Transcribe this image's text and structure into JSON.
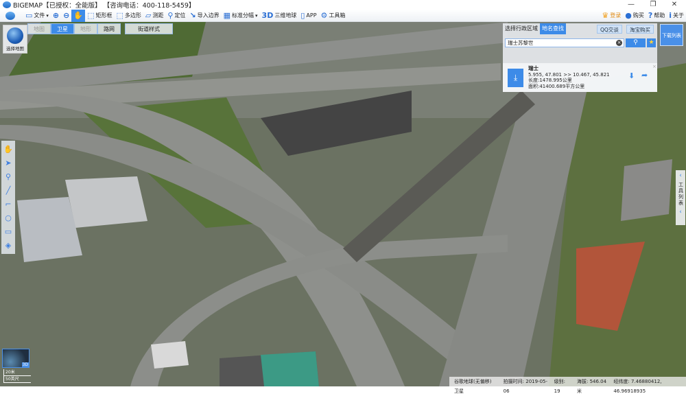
{
  "window": {
    "title": "BIGEMAP【已授权：全能版】 【咨询电话：400-118-5459】",
    "minimize": "—",
    "restore": "❐",
    "close": "✕"
  },
  "toolbar": {
    "items": [
      {
        "label": "文件",
        "icon": "folder-icon",
        "glyph": "▭",
        "dropdown": true
      },
      {
        "label": "",
        "icon": "zoom-in-icon",
        "glyph": "⊕"
      },
      {
        "label": "",
        "icon": "zoom-out-icon",
        "glyph": "⊖"
      },
      {
        "label": "",
        "icon": "hand-pan-icon",
        "glyph": "✋",
        "active": true
      },
      {
        "label": "矩形框",
        "icon": "rectangle-select-icon",
        "glyph": "⬚"
      },
      {
        "label": "多边形",
        "icon": "polygon-select-icon",
        "glyph": "⬚"
      },
      {
        "label": "测距",
        "icon": "ruler-icon",
        "glyph": "▱"
      },
      {
        "label": "定位",
        "icon": "location-pin-icon",
        "glyph": "⚲"
      },
      {
        "label": "导入边界",
        "icon": "import-boundary-icon",
        "glyph": "↘"
      },
      {
        "label": "标准分幅",
        "icon": "grid-icon",
        "glyph": "▦",
        "dropdown": true
      },
      {
        "label": "三维地球",
        "icon": "3d-icon",
        "glyph": "3D"
      },
      {
        "label": "APP",
        "icon": "phone-app-icon",
        "glyph": "▯"
      },
      {
        "label": "工具箱",
        "icon": "gear-icon",
        "glyph": "⚙"
      }
    ],
    "right": [
      {
        "label": "登录",
        "icon": "login-badge-icon",
        "glyph": "♛"
      },
      {
        "label": "购买",
        "icon": "buy-icon",
        "glyph": "●"
      },
      {
        "label": "帮助",
        "icon": "help-icon",
        "glyph": "?"
      },
      {
        "label": "关于",
        "icon": "about-icon",
        "glyph": "i"
      }
    ]
  },
  "map_types": {
    "items": [
      "地图",
      "卫星",
      "地形",
      "路网"
    ],
    "active": "卫星",
    "street_style": "街道样式"
  },
  "globe": {
    "label": "选择地图"
  },
  "left_tools": [
    "hand-icon",
    "arrow-icon",
    "marker-icon",
    "line-icon",
    "polyline-icon",
    "circle-icon",
    "rectangle-icon",
    "eraser-icon"
  ],
  "search_panel": {
    "tab_region": "选择行政区域",
    "tab_search": "地名查找",
    "qq": "QQ交谈",
    "taobao": "淘宝购买",
    "query": "瑞士苏黎世",
    "clear": "×",
    "search_glyph": "⚲",
    "star_glyph": "★"
  },
  "result": {
    "name": "瑞士",
    "coords": "5.955, 47.801 >> 10.467, 45.821",
    "length": "长度:1478.995公里",
    "area": "面积:41400.689平方公里",
    "close": "×"
  },
  "download_list": "下载列表",
  "tool_list": {
    "label": "工具列表",
    "chevron": "‹"
  },
  "minimap": {
    "label": "3D"
  },
  "scale": {
    "metric": "20米",
    "imperial": "50英尺"
  },
  "status": {
    "source": "谷歌地球(无偏移) 卫星",
    "date": "拍摄时间: 2019-05-06",
    "level": "级别: 19",
    "altitude": "海拔: 546.04米",
    "coords": "经纬度: 7.46880412, 46.96918935"
  },
  "colors": {
    "accent": "#3d8be8"
  }
}
